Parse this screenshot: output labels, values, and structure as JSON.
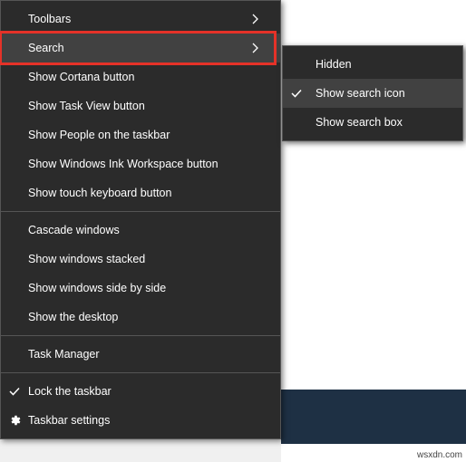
{
  "menu": {
    "groups": [
      [
        {
          "id": "toolbars",
          "label": "Toolbars",
          "hasSubmenu": true,
          "checked": false,
          "icon": null,
          "hovered": false,
          "highlighted": false
        },
        {
          "id": "search",
          "label": "Search",
          "hasSubmenu": true,
          "checked": false,
          "icon": null,
          "hovered": true,
          "highlighted": true
        },
        {
          "id": "cortana",
          "label": "Show Cortana button",
          "hasSubmenu": false,
          "checked": false,
          "icon": null,
          "hovered": false,
          "highlighted": false
        },
        {
          "id": "taskview",
          "label": "Show Task View button",
          "hasSubmenu": false,
          "checked": false,
          "icon": null,
          "hovered": false,
          "highlighted": false
        },
        {
          "id": "people",
          "label": "Show People on the taskbar",
          "hasSubmenu": false,
          "checked": false,
          "icon": null,
          "hovered": false,
          "highlighted": false
        },
        {
          "id": "ink",
          "label": "Show Windows Ink Workspace button",
          "hasSubmenu": false,
          "checked": false,
          "icon": null,
          "hovered": false,
          "highlighted": false
        },
        {
          "id": "touchkb",
          "label": "Show touch keyboard button",
          "hasSubmenu": false,
          "checked": false,
          "icon": null,
          "hovered": false,
          "highlighted": false
        }
      ],
      [
        {
          "id": "cascade",
          "label": "Cascade windows",
          "hasSubmenu": false,
          "checked": false,
          "icon": null,
          "hovered": false,
          "highlighted": false
        },
        {
          "id": "stacked",
          "label": "Show windows stacked",
          "hasSubmenu": false,
          "checked": false,
          "icon": null,
          "hovered": false,
          "highlighted": false
        },
        {
          "id": "sidebyside",
          "label": "Show windows side by side",
          "hasSubmenu": false,
          "checked": false,
          "icon": null,
          "hovered": false,
          "highlighted": false
        },
        {
          "id": "desktop",
          "label": "Show the desktop",
          "hasSubmenu": false,
          "checked": false,
          "icon": null,
          "hovered": false,
          "highlighted": false
        }
      ],
      [
        {
          "id": "taskmgr",
          "label": "Task Manager",
          "hasSubmenu": false,
          "checked": false,
          "icon": null,
          "hovered": false,
          "highlighted": false
        }
      ],
      [
        {
          "id": "lock",
          "label": "Lock the taskbar",
          "hasSubmenu": false,
          "checked": true,
          "icon": null,
          "hovered": false,
          "highlighted": false
        },
        {
          "id": "settings",
          "label": "Taskbar settings",
          "hasSubmenu": false,
          "checked": false,
          "icon": "gear",
          "hovered": false,
          "highlighted": false
        }
      ]
    ]
  },
  "submenu": {
    "items": [
      {
        "id": "hidden",
        "label": "Hidden",
        "checked": false,
        "hovered": false
      },
      {
        "id": "showicon",
        "label": "Show search icon",
        "checked": true,
        "hovered": true
      },
      {
        "id": "showbox",
        "label": "Show search box",
        "checked": false,
        "hovered": false
      }
    ]
  },
  "watermark": "wsxdn.com"
}
